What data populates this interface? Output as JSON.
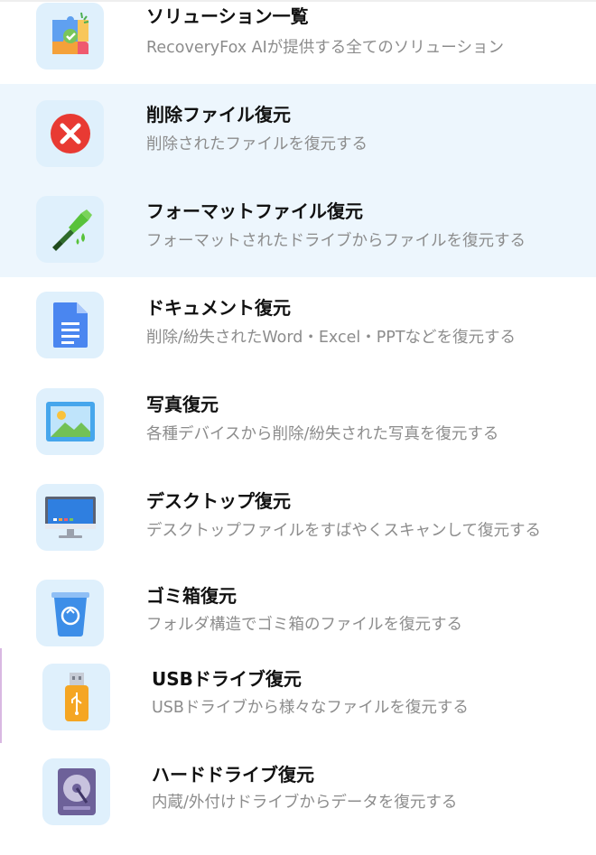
{
  "menu": {
    "items": [
      {
        "title": "ソリューション一覧",
        "desc": "RecoveryFox AIが提供する全てのソリューション",
        "icon": "puzzle-icon"
      },
      {
        "title": "削除ファイル復元",
        "desc": "削除されたファイルを復元する",
        "icon": "delete-x-icon"
      },
      {
        "title": "フォーマットファイル復元",
        "desc": "フォーマットされたドライブからファイルを復元する",
        "icon": "paint-brush-icon"
      },
      {
        "title": "ドキュメント復元",
        "desc": "削除/紛失されたWord・Excel・PPTなどを復元する",
        "icon": "document-icon"
      },
      {
        "title": "写真復元",
        "desc": "各種デバイスから削除/紛失された写真を復元する",
        "icon": "photo-icon"
      },
      {
        "title": "デスクトップ復元",
        "desc": "デスクトップファイルをすばやくスキャンして復元する",
        "icon": "desktop-monitor-icon"
      },
      {
        "title": "ゴミ箱復元",
        "desc": "フォルダ構造でゴミ箱のファイルを復元する",
        "icon": "recycle-bin-icon"
      },
      {
        "title": "USBドライブ復元",
        "desc": "USBドライブから様々なファイルを復元する",
        "icon": "usb-drive-icon"
      },
      {
        "title": "ハードドライブ復元",
        "desc": "内蔵/外付けドライブからデータを復元する",
        "icon": "hard-drive-icon"
      }
    ]
  }
}
